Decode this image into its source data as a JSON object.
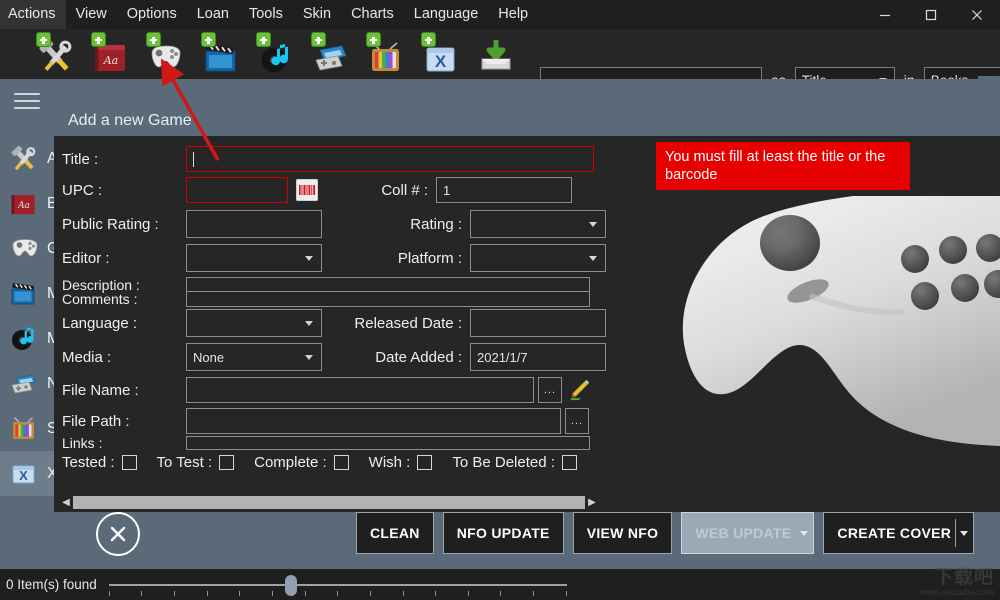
{
  "window": {
    "controls": {
      "minimize": "minimize-icon",
      "maximize": "maximize-icon",
      "close": "close-icon"
    }
  },
  "menubar": {
    "items": [
      {
        "label": "Actions"
      },
      {
        "label": "View"
      },
      {
        "label": "Options"
      },
      {
        "label": "Loan"
      },
      {
        "label": "Tools"
      },
      {
        "label": "Skin"
      },
      {
        "label": "Charts"
      },
      {
        "label": "Language"
      },
      {
        "label": "Help"
      }
    ]
  },
  "toolbar": {
    "icons": [
      {
        "name": "add-tools-icon",
        "title": "Add Tool"
      },
      {
        "name": "add-book-icon",
        "title": "Add Book"
      },
      {
        "name": "add-game-icon",
        "title": "Add Game"
      },
      {
        "name": "add-movie-icon",
        "title": "Add Movie"
      },
      {
        "name": "add-music-icon",
        "title": "Add Music"
      },
      {
        "name": "add-console-icon",
        "title": "Add Console"
      },
      {
        "name": "add-serie-icon",
        "title": "Add Serie"
      },
      {
        "name": "add-xrecord-icon",
        "title": "Add X"
      },
      {
        "name": "import-download-icon",
        "title": "Import"
      }
    ]
  },
  "search": {
    "value": "",
    "placeholder": "",
    "as_label": "as",
    "as_value": "Title",
    "in_label": "in",
    "in_value": "Books"
  },
  "sidebar": {
    "menu_icon": "hamburger-icon",
    "items": [
      {
        "label": "A",
        "icon": "tools-icon"
      },
      {
        "label": "B",
        "icon": "book-icon"
      },
      {
        "label": "G",
        "icon": "gamepad-icon"
      },
      {
        "label": "M",
        "icon": "movie-icon"
      },
      {
        "label": "M",
        "icon": "music-icon"
      },
      {
        "label": "N",
        "icon": "console-icon"
      },
      {
        "label": "S",
        "icon": "tv-icon"
      },
      {
        "label": "X",
        "icon": "x-folder-icon"
      }
    ]
  },
  "dialog": {
    "title": "Add a new Game",
    "error_message": "You must fill at least the title or the barcode",
    "fields": {
      "title": {
        "label": "Title :",
        "value": ""
      },
      "upc": {
        "label": "UPC :",
        "value": ""
      },
      "barcode_icon": "barcode-icon",
      "coll_num": {
        "label": "Coll # :",
        "value": "1"
      },
      "public_rating": {
        "label": "Public Rating :",
        "value": ""
      },
      "rating": {
        "label": "Rating :",
        "value": ""
      },
      "editor": {
        "label": "Editor :",
        "value": ""
      },
      "platform": {
        "label": "Platform :",
        "value": ""
      },
      "description": {
        "label": "Description :",
        "value": ""
      },
      "comments": {
        "label": "Comments :",
        "value": ""
      },
      "language": {
        "label": "Language :",
        "value": ""
      },
      "released_date": {
        "label": "Released Date :",
        "value": ""
      },
      "media": {
        "label": "Media :",
        "value": "None"
      },
      "date_added": {
        "label": "Date Added :",
        "value": "2021/1/7"
      },
      "file_name": {
        "label": "File Name :",
        "value": "",
        "browse": "...",
        "edit_icon": "pencil-icon"
      },
      "file_path": {
        "label": "File Path :",
        "value": "",
        "browse": "..."
      },
      "links": {
        "label": "Links :",
        "value": ""
      }
    },
    "checkboxes": [
      {
        "label": "Tested :",
        "checked": false
      },
      {
        "label": "To Test :",
        "checked": false
      },
      {
        "label": "Complete :",
        "checked": false
      },
      {
        "label": "Wish :",
        "checked": false
      },
      {
        "label": "To Be Deleted :",
        "checked": false
      }
    ],
    "footer": {
      "close_icon": "close-circle-icon",
      "buttons": [
        {
          "label": "CLEAN",
          "disabled": false,
          "split": false
        },
        {
          "label": "NFO UPDATE",
          "disabled": false,
          "split": false
        },
        {
          "label": "VIEW NFO",
          "disabled": false,
          "split": false
        },
        {
          "label": "WEB UPDATE",
          "disabled": true,
          "split": true
        },
        {
          "label": "CREATE COVER",
          "disabled": false,
          "split": true
        }
      ]
    }
  },
  "statusbar": {
    "items_found": "0 Item(s) found",
    "slider_value": 38
  },
  "watermark": {
    "text_cn": "下载吧",
    "url": "www.xiazaiba.com"
  },
  "colors": {
    "accent_red": "#e60000",
    "panel_blue": "#5b6a78",
    "form_bg": "#262626",
    "menubar_bg": "#1f1f1f"
  }
}
